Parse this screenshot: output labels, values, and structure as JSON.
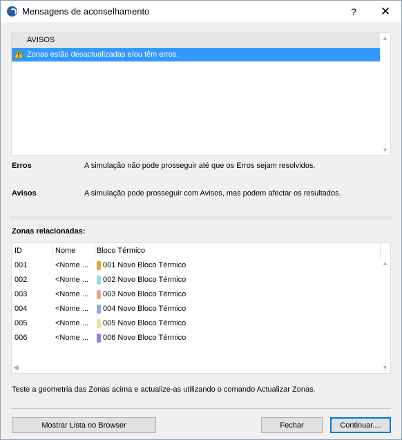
{
  "window": {
    "title": "Mensagens de aconselhamento",
    "help": "?",
    "close": "✕"
  },
  "messages": {
    "header": "AVISOS",
    "items": [
      {
        "type": "warning",
        "text": "Zonas estão desactualizadas e/ou têm erros.",
        "selected": true
      }
    ]
  },
  "legend": {
    "errors_label": "Erros",
    "errors_text": "A simulação não pode prosseguir até que os Erros sejam resolvidos.",
    "warnings_label": "Avisos",
    "warnings_text": "A simulação pode prosseguir com Avisos, mas podem afectar os resultados."
  },
  "zones": {
    "title": "Zonas relacionadas:",
    "columns": [
      "ID",
      "Nome",
      "Bloco Térmico"
    ],
    "rows": [
      {
        "id": "001",
        "name": "<Nome ...",
        "block": "001 Novo Bloco Térmico",
        "color": "#e8a33a"
      },
      {
        "id": "002",
        "name": "<Nome ...",
        "block": "002 Novo Bloco Térmico",
        "color": "#8ee0e8"
      },
      {
        "id": "003",
        "name": "<Nome ...",
        "block": "003 Novo Bloco Térmico",
        "color": "#f0a28a"
      },
      {
        "id": "004",
        "name": "<Nome ...",
        "block": "004 Novo Bloco Térmico",
        "color": "#8aaee0"
      },
      {
        "id": "005",
        "name": "<Nome ...",
        "block": "005 Novo Bloco Térmico",
        "color": "#ece09a"
      },
      {
        "id": "006",
        "name": "<Nome ...",
        "block": "006 Novo Bloco Térmico",
        "color": "#9a7ae0"
      }
    ]
  },
  "hint": "Teste a geometria das Zonas acima e actualize-as utilizando o comando Actualizar Zonas.",
  "buttons": {
    "browser": "Mostrar Lista no Browser",
    "close": "Fechar",
    "continue": "Continuar...."
  }
}
